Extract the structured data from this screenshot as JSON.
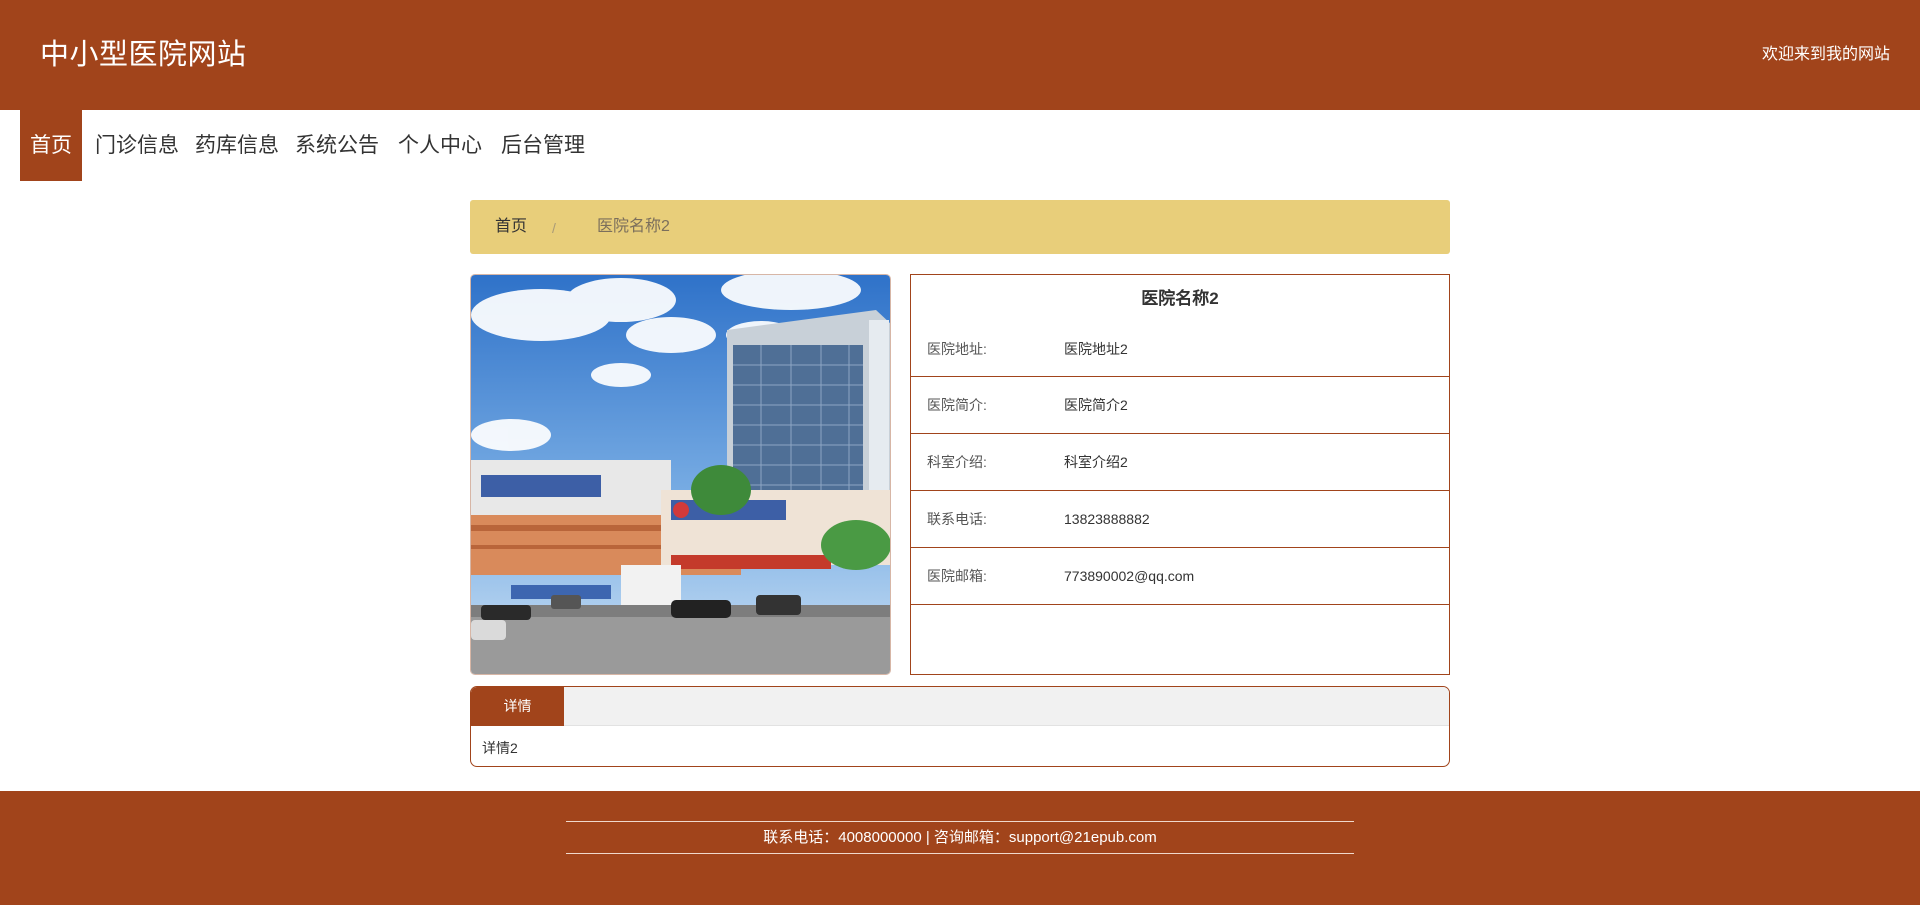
{
  "header": {
    "site_title": "中小型医院网站",
    "welcome": "欢迎来到我的网站"
  },
  "nav": {
    "items": [
      {
        "label": "首页",
        "active": true
      },
      {
        "label": "门诊信息",
        "active": false
      },
      {
        "label": "药库信息",
        "active": false
      },
      {
        "label": "系统公告",
        "active": false
      },
      {
        "label": "个人中心",
        "active": false
      },
      {
        "label": "后台管理",
        "active": false
      }
    ]
  },
  "breadcrumb": {
    "home": "首页",
    "separator": "/",
    "current": "医院名称2"
  },
  "hospital": {
    "name": "医院名称2",
    "fields": [
      {
        "label": "医院地址:",
        "value": "医院地址2"
      },
      {
        "label": "医院简介:",
        "value": "医院简介2"
      },
      {
        "label": "科室介绍:",
        "value": "科室介绍2"
      },
      {
        "label": "联系电话:",
        "value": "13823888882"
      },
      {
        "label": "医院邮箱:",
        "value": "773890002@qq.com"
      }
    ]
  },
  "details": {
    "tab_label": "详情",
    "content": "详情2"
  },
  "footer": {
    "text": "联系电话：4008000000 | 咨询邮箱：support@21epub.com"
  },
  "colors": {
    "primary": "#a1441b",
    "breadcrumb_bg": "#e8ce7a",
    "tab_bar_bg": "#f1f1f1"
  }
}
